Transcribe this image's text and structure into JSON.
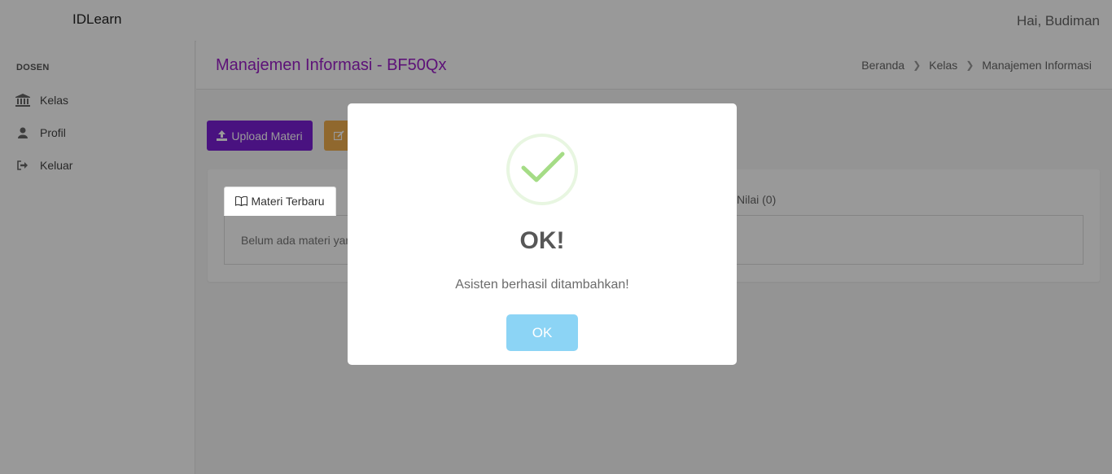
{
  "app": {
    "brand": "IDLearn",
    "greeting": "Hai, Budiman"
  },
  "sidebar": {
    "heading": "DOSEN",
    "items": [
      {
        "label": "Kelas",
        "icon": "institution-icon"
      },
      {
        "label": "Profil",
        "icon": "user-icon"
      },
      {
        "label": "Keluar",
        "icon": "sign-out-icon"
      }
    ]
  },
  "page": {
    "title": "Manajemen Informasi - BF50Qx",
    "breadcrumb": [
      "Beranda",
      "Kelas",
      "Manajemen Informasi"
    ]
  },
  "toolbar": {
    "upload_label": "Upload Materi",
    "upload_color": "#7a1fd6",
    "edit_color": "#f0ad4e"
  },
  "tabs": {
    "active_label": "Materi Terbaru",
    "right_label": "Nilai (0)",
    "empty_text": "Belum ada materi yan"
  },
  "modal": {
    "title": "OK!",
    "text": "Asisten berhasil ditambahkan!",
    "button_label": "OK",
    "icon": "checkmark-icon",
    "button_color": "#8cd4f5",
    "icon_color": "#a5dc86"
  }
}
